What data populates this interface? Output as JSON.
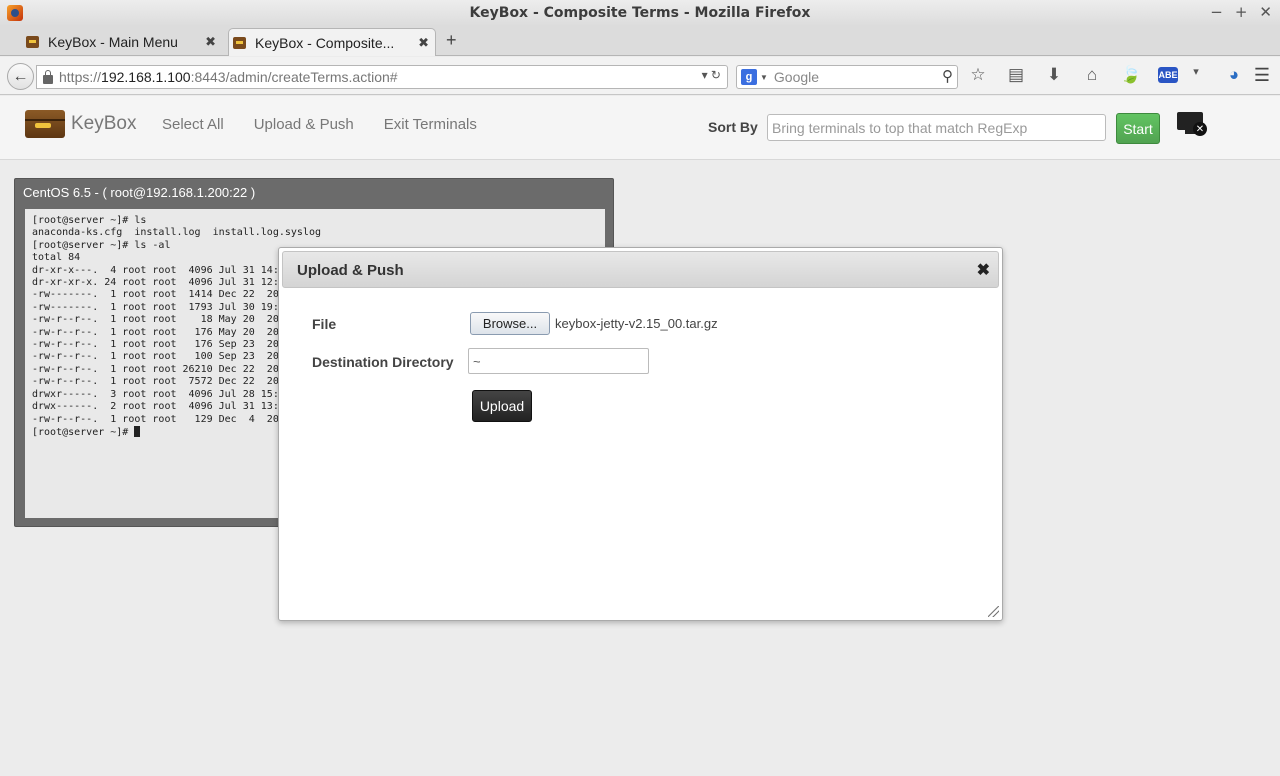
{
  "window": {
    "title": "KeyBox - Composite Terms - Mozilla Firefox",
    "controls": [
      "−",
      "+",
      "✕"
    ]
  },
  "tabs": [
    {
      "label": "KeyBox - Main Menu",
      "close": "✖"
    },
    {
      "label": "KeyBox - Composite...",
      "close": "✖"
    }
  ],
  "new_tab": "+",
  "nav": {
    "back": "←",
    "url_scheme": "https://",
    "url_host": "192.168.1.100",
    "url_rest": ":8443/admin/createTerms.action#",
    "url_icons": "▾  ↻",
    "search_engine": "g",
    "search_placeholder": "Google",
    "toolbar_icons": [
      "☆",
      "▤",
      "⬇",
      "⌂",
      "🍃",
      "ABE",
      "▾",
      "◕"
    ]
  },
  "app": {
    "brand": "KeyBox",
    "nav_items": [
      "Select All",
      "Upload & Push",
      "Exit Terminals"
    ],
    "sort_label": "Sort By",
    "sort_placeholder": "Bring terminals to top that match RegExp",
    "start_label": "Start"
  },
  "terminal": {
    "title": "CentOS 6.5 - ( root@192.168.1.200:22 )",
    "lines": [
      "[root@server ~]# ls",
      "anaconda-ks.cfg  install.log  install.log.syslog",
      "[root@server ~]# ls -al",
      "total 84",
      "dr-xr-x---.  4 root root  4096 Jul 31 14:",
      "dr-xr-xr-x. 24 root root  4096 Jul 31 12:",
      "-rw-------.  1 root root  1414 Dec 22  20",
      "-rw-------.  1 root root  1793 Jul 30 19:",
      "-rw-r--r--.  1 root root    18 May 20  20",
      "-rw-r--r--.  1 root root   176 May 20  20",
      "-rw-r--r--.  1 root root   176 Sep 23  20",
      "-rw-r--r--.  1 root root   100 Sep 23  20",
      "-rw-r--r--.  1 root root 26210 Dec 22  20",
      "-rw-r--r--.  1 root root  7572 Dec 22  20",
      "drwxr-----.  3 root root  4096 Jul 28 15:",
      "drwx------.  2 root root  4096 Jul 31 13:",
      "-rw-r--r--.  1 root root   129 Dec  4  20"
    ],
    "prompt": "[root@server ~]# "
  },
  "dialog": {
    "title": "Upload & Push",
    "close": "✖",
    "file_label": "File",
    "browse_label": "Browse...",
    "file_name": "keybox-jetty-v2.15_00.tar.gz",
    "dest_label": "Destination Directory",
    "dest_value": "~",
    "upload_label": "Upload"
  }
}
